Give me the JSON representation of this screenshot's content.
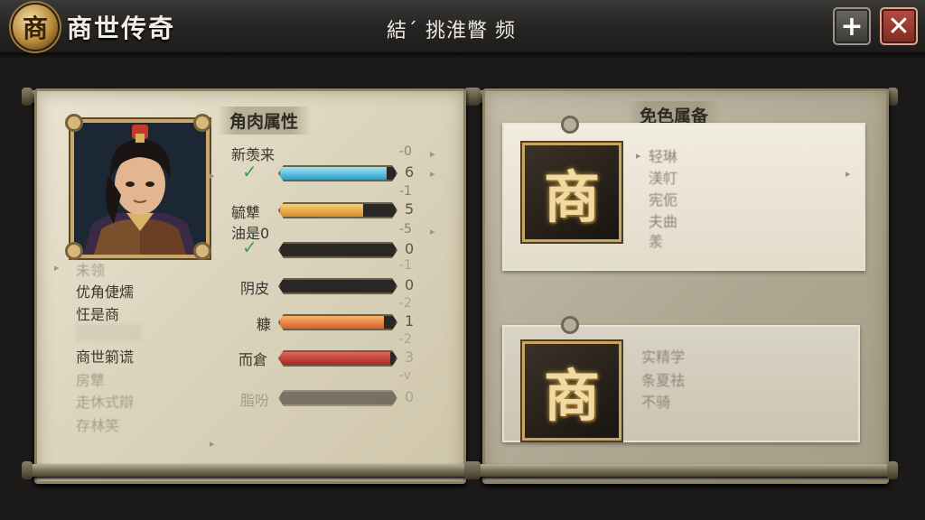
{
  "header": {
    "logo_glyph": "商",
    "app_title": "商世传奇",
    "center_title": "結΄ 挑淮瞥 频",
    "add_label": "+",
    "close_label": "✕"
  },
  "left_panel": {
    "section_title": "角肉属性",
    "menu": [
      {
        "label": "未领",
        "faint": true
      },
      {
        "label": "优角倢燸",
        "faint": false
      },
      {
        "label": "忹是商",
        "faint": false
      },
      {
        "label": "商世箣谎",
        "faint": false
      },
      {
        "label": "房犨",
        "faint": true
      },
      {
        "label": "走休式辯",
        "faint": true
      },
      {
        "label": "存林笑",
        "faint": true
      }
    ],
    "stats": [
      {
        "label": "新羡来",
        "value": "-0",
        "bar": false
      },
      {
        "label": "",
        "value": "6",
        "bar": true,
        "checked": true,
        "fill": 0.92,
        "color": "#49b6d6"
      },
      {
        "label": "",
        "value": "-1",
        "bar": false
      },
      {
        "label": "毓犨",
        "value": "5",
        "bar": true,
        "fill": 0.72,
        "color": "#e39a3c"
      },
      {
        "label": "油是0",
        "value": "-5",
        "bar": false
      },
      {
        "label": "",
        "value": "0",
        "bar": true,
        "checked": true,
        "fill": 0.0,
        "color": "#555"
      },
      {
        "label": "",
        "value": "-1",
        "bar": false
      },
      {
        "label": "阴皮",
        "value": "0",
        "bar": true,
        "fill": 0.0,
        "color": "#555"
      },
      {
        "label": "",
        "value": "-2",
        "bar": false
      },
      {
        "label": "糠",
        "value": "1",
        "bar": true,
        "fill": 0.9,
        "color": "#e67a34"
      },
      {
        "label": "",
        "value": "-2",
        "bar": false
      },
      {
        "label": "而倉",
        "value": "3",
        "bar": true,
        "fill": 0.95,
        "color": "#c03a2f"
      },
      {
        "label": "",
        "value": "-v",
        "bar": false
      },
      {
        "label": "脂吩",
        "value": "0",
        "bar": true,
        "fill": 0.0,
        "color": "#777"
      }
    ]
  },
  "right_panel": {
    "section_title": "免色属备",
    "card1": {
      "emblem_glyph": "商",
      "lines": [
        "轻琳",
        "渼帄",
        "宪伌",
        "夫曲",
        "羕"
      ]
    },
    "card2": {
      "emblem_glyph": "商",
      "lines": [
        "实精学",
        "条夏祛",
        "不骑"
      ]
    }
  }
}
